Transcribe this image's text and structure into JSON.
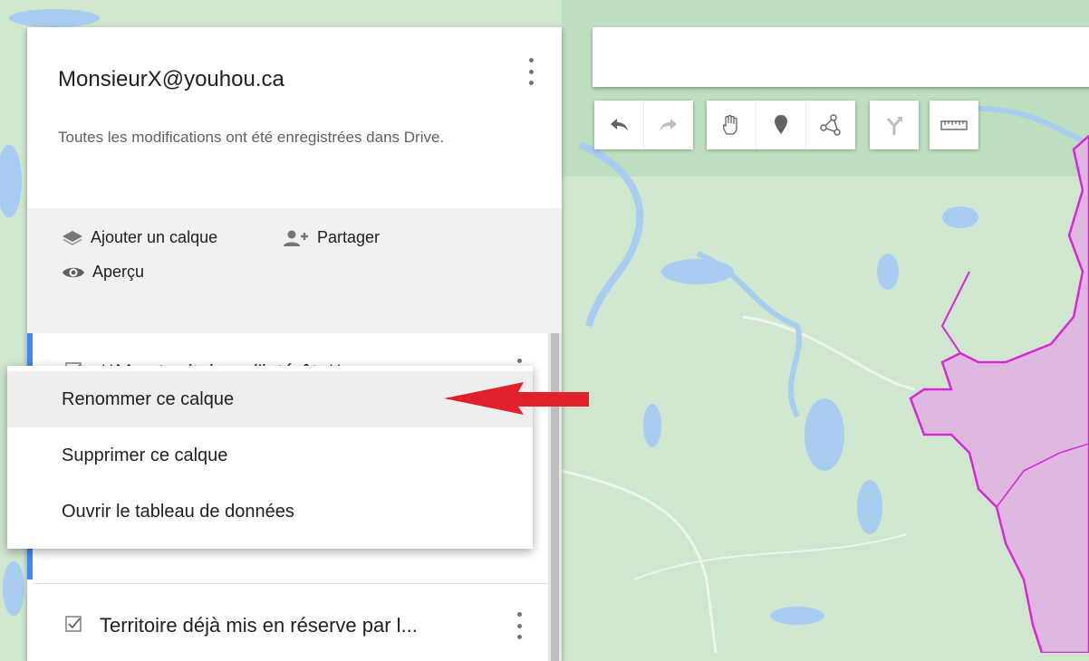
{
  "colors": {
    "map_green": "#cfe7cf",
    "water": "#a9cdf0",
    "territory_fill": "#dfb8e0",
    "territory_border": "#d926d9",
    "accent": "#4285f4",
    "annotation_arrow": "#e0202a"
  },
  "header": {
    "title": "MonsieurX@youhou.ca",
    "status": "Toutes les modifications ont été enregistrées dans Drive.",
    "menu_icon": "more-vert-icon"
  },
  "actions": {
    "add_layer": {
      "label": "Ajouter un calque",
      "icon": "layers-icon"
    },
    "share": {
      "label": "Partager",
      "icon": "person-add-icon"
    },
    "preview": {
      "label": "Aperçu",
      "icon": "eye-icon"
    }
  },
  "layers": [
    {
      "title": "**Mes territoires d'intérêts**",
      "checked": true
    },
    {
      "title": "Territoire déjà mis en réserve par l...",
      "checked": true
    }
  ],
  "context_menu": {
    "items": [
      {
        "label": "Renommer ce calque",
        "active": true
      },
      {
        "label": "Supprimer ce calque",
        "active": false
      },
      {
        "label": "Ouvrir le tableau de données",
        "active": false
      }
    ]
  },
  "search": {
    "placeholder": ""
  },
  "toolbar": {
    "undo": "undo-icon",
    "redo": "redo-icon",
    "pan": "hand-icon",
    "marker": "place-marker-icon",
    "draw_line": "draw-line-icon",
    "directions": "directions-icon",
    "measure": "ruler-icon"
  }
}
